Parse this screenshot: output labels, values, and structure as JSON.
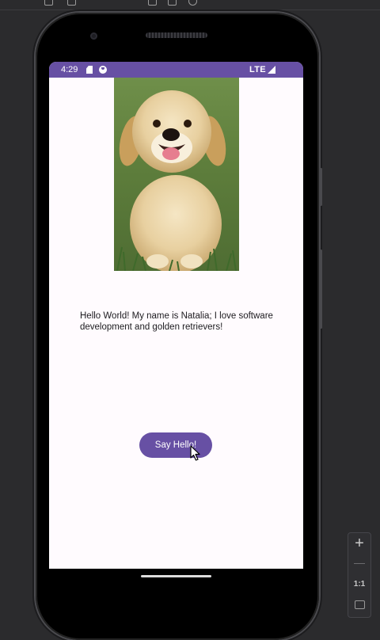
{
  "status_bar": {
    "time": "4:29",
    "network": "LTE",
    "icons": [
      "sd-card-icon",
      "notification-round-icon",
      "signal-icon"
    ],
    "color": "#6750a4"
  },
  "main": {
    "intro_text": "Hello World! My name is Natalia; I love software development and golden retrievers!",
    "button_label": "Say Hello!"
  },
  "emulator": {
    "zoom_in_label": "+",
    "zoom_actual_label": "1:1"
  },
  "colors": {
    "accent": "#6750a4",
    "background": "#fffbfe"
  }
}
